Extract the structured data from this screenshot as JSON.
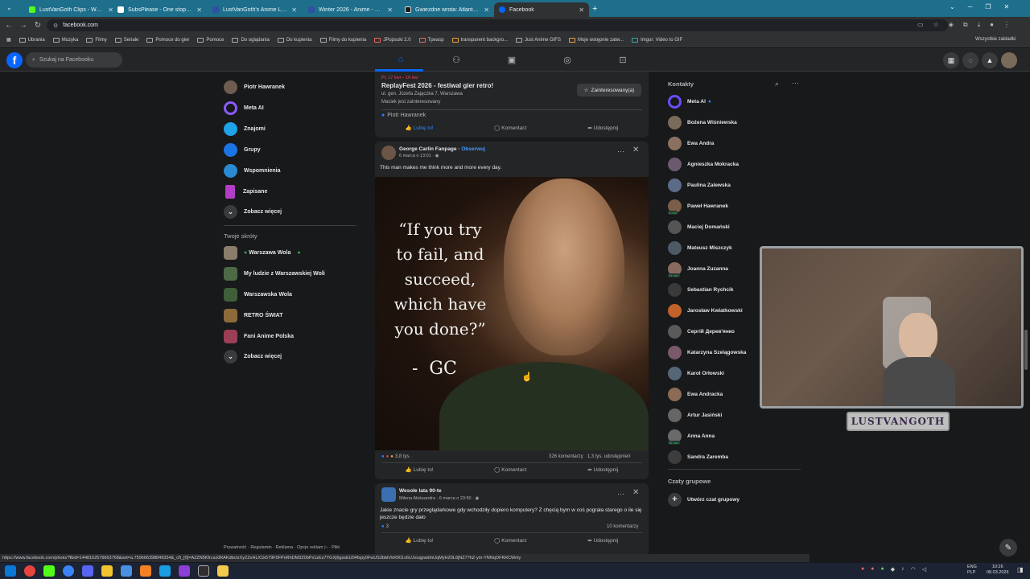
{
  "tabs": [
    {
      "title": "LustVanGoth Clips - Watch Live",
      "color": "#53fc18",
      "active": false
    },
    {
      "title": "SubsPlease - One stop shop fo",
      "color": "#ffffff",
      "active": false
    },
    {
      "title": "LustVanGoth's Anime List - My",
      "color": "#2e51a2",
      "active": false
    },
    {
      "title": "Winter 2026 - Anime - MyAnim",
      "color": "#2e51a2",
      "active": false
    },
    {
      "title": "Gwiezdne wrota: Atlantyda / St",
      "color": "#1a1a1a",
      "active": false
    },
    {
      "title": "Facebook",
      "color": "#0866ff",
      "active": true
    }
  ],
  "url": "facebook.com",
  "bookmarks": [
    "Ubrania",
    "Muzyka",
    "Filmy",
    "Seriale",
    "Pomoce do gier",
    "Pomoce",
    "Do oglądania",
    "Do kupienia",
    "Filmy do kupienia",
    "JPopsuki 2.0",
    "Tpeasp",
    "transparent backgro...",
    "Just Anime GIFS",
    "Moje wstępnie zatw...",
    "Imgur: Video to GIF"
  ],
  "bookmarks_right": "Wszystkie zakładki",
  "fb": {
    "search_placeholder": "Szukaj na Facebooku",
    "left_menu": [
      "Piotr Hawranek",
      "Meta AI",
      "Znajomi",
      "Grupy",
      "Wspomnienia",
      "Zapisane",
      "Zobacz więcej"
    ],
    "shortcuts_title": "Twoje skróty",
    "shortcuts": [
      "Warszawa Wola",
      "My ludzie z Warszawskiej Woli",
      "Warszawska Wola",
      "RETRO ŚWIAT",
      "Fani Anime Polska",
      "Zobacz więcej"
    ],
    "footer": "Prywatność · Regulamin · Reklama · Opcje reklam ▷ · Pliki"
  },
  "event": {
    "date": "Pt, 17 kwi – 19 kwi",
    "title": "ReplayFest 2026 - festiwal gier retro!",
    "address": "ul. gen. Józefa Zajączka 7, Warszawa",
    "interested_note": "Maciek jest zainteresowany",
    "interested_button": "Zainteresowany(a)",
    "liker": "Piotr Hawranek",
    "like": "Lubię to!",
    "comment": "Komentarz",
    "share": "Udostępnij"
  },
  "post1": {
    "author": "George Carlin Fanpage",
    "follow": "Obserwuj",
    "time": "6 marca o 13:01 · ◉",
    "text": "This man makes me think more and more every day.",
    "quote": "“If you try to fail, and succeed, which have you done?”",
    "quote_lines": [
      "“If you try",
      "to fail, and",
      "succeed,",
      "which have",
      "you done?”"
    ],
    "signature": "-  GC",
    "reactions": "3,8 tys.",
    "comments": "326 komentarzy",
    "shares": "1,3 tys. udostępnień",
    "like": "Lubię to!",
    "comment": "Komentarz",
    "share": "Udostępnij"
  },
  "post2": {
    "author": "Wesołe lata 90-te",
    "sub": "Milena Aleksandra · 6 marca o 23:50 · ◉",
    "text": "Jakie znacie gry przeglądarkowe gdy wchodziły dopiero komputery? Z chęcią bym w coś pograła starego o ile się jeszcze będzie dało",
    "reactions": "3",
    "comments": "10 komentarzy",
    "like": "Lubię to!",
    "comment": "Komentarz",
    "share": "Udostępnij"
  },
  "contacts_title": "Kontakty",
  "contacts": [
    {
      "name": "Meta AI",
      "badge": "",
      "color": "#6b4cff"
    },
    {
      "name": "Bożena Wiśniewska",
      "badge": "",
      "color": "#7a6a5a"
    },
    {
      "name": "Ewa Andra",
      "badge": "",
      "color": "#8a7060"
    },
    {
      "name": "Agnieszka Mokracka",
      "badge": "",
      "color": "#6b5a6e"
    },
    {
      "name": "Paulina Zalewska",
      "badge": "",
      "color": "#5c6c88"
    },
    {
      "name": "Paweł Hawranek",
      "badge": "8 min",
      "color": "#7c5d4a"
    },
    {
      "name": "Maciej Domański",
      "badge": "",
      "color": "#555"
    },
    {
      "name": "Mateusz Miszczyk",
      "badge": "",
      "color": "#4d5a66"
    },
    {
      "name": "Joanna Zuzanna",
      "badge": "24 min",
      "color": "#8a6a5e"
    },
    {
      "name": "Sebastian Rychcik",
      "badge": "",
      "color": "#3a3a3a"
    },
    {
      "name": "Jarosław Kwiatkowski",
      "badge": "",
      "color": "#c0622a"
    },
    {
      "name": "Сергій Дерев'янко",
      "badge": "",
      "color": "#5a5a5a"
    },
    {
      "name": "Katarzyna Szelągowska",
      "badge": "",
      "color": "#7a5a6a"
    },
    {
      "name": "Karol Orłowski",
      "badge": "",
      "color": "#556677"
    },
    {
      "name": "Ewa Andracka",
      "badge": "",
      "color": "#8b6b55"
    },
    {
      "name": "Artur Jasiński",
      "badge": "",
      "color": "#666"
    },
    {
      "name": "Anna Anna",
      "badge": "34 min",
      "color": "#6a6a6a"
    },
    {
      "name": "Sandra Zaremba",
      "badge": "",
      "color": "#3d3d3d"
    }
  ],
  "group_chats_title": "Czaty grupowe",
  "create_group": "Utwórz czat grupowy",
  "webcam_label": "LUSTVANGOTH",
  "status_url": "https://www.facebook.com/photo/?fbid=1448162576663768&set=a.759666398849334&_cft_[0]=AZZN5Kfrcsz0RAKdbctzXyZZvHLX1k579F5FPnRhDM3Z0bPx1zEz7YGXj6gssEU04fspy0FwUS2bbtVkR001x6UJvuqpwdmUqMyHZ0L6jNZ7?hZ-ym-YNNqOFKRCWnly",
  "clock": {
    "time": "10:26",
    "date": "08.03.2026",
    "lang": "ENG\nPLP"
  }
}
